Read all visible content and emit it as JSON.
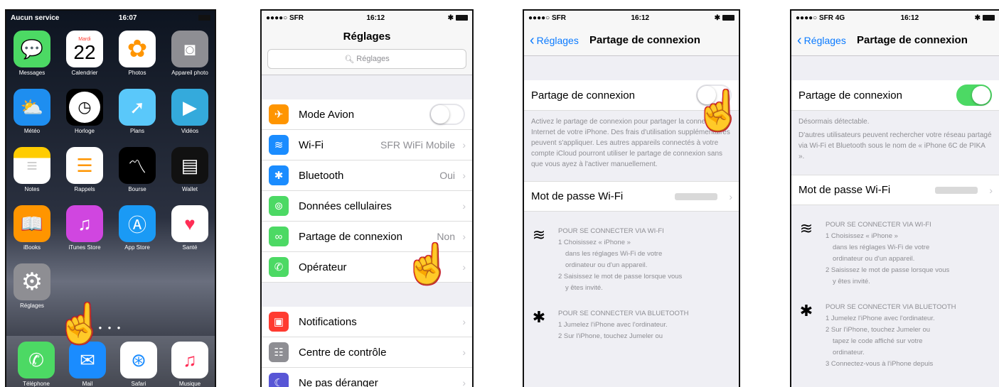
{
  "phone1": {
    "status": {
      "carrier": "Aucun service",
      "time": "16:07"
    },
    "apps": [
      {
        "label": "Messages",
        "color": "#4cd964"
      },
      {
        "label": "Calendrier",
        "color": "#ffffff",
        "day": "Mardi",
        "date": "22"
      },
      {
        "label": "Photos",
        "color": "#ffffff"
      },
      {
        "label": "Appareil photo",
        "color": "#8e8e93"
      },
      {
        "label": "Météo",
        "color": "#1e8ef0"
      },
      {
        "label": "Horloge",
        "color": "#000000"
      },
      {
        "label": "Plans",
        "color": "#5ac8fa"
      },
      {
        "label": "Vidéos",
        "color": "#34aadc"
      },
      {
        "label": "Notes",
        "color": "#ffcc00"
      },
      {
        "label": "Rappels",
        "color": "#ffffff"
      },
      {
        "label": "Bourse",
        "color": "#000000"
      },
      {
        "label": "Wallet",
        "color": "#111111"
      },
      {
        "label": "iBooks",
        "color": "#ff9500"
      },
      {
        "label": "iTunes Store",
        "color": "#d046e0"
      },
      {
        "label": "App Store",
        "color": "#1a9af5"
      },
      {
        "label": "Santé",
        "color": "#ffffff"
      },
      {
        "label": "Réglages",
        "color": "#8e8e93"
      }
    ],
    "dock": [
      {
        "label": "Téléphone",
        "color": "#4cd964"
      },
      {
        "label": "Mail",
        "color": "#1a8cff"
      },
      {
        "label": "Safari",
        "color": "#ffffff"
      },
      {
        "label": "Musique",
        "color": "#ffffff"
      }
    ]
  },
  "phone2": {
    "status": {
      "carrier": "●●●●○ SFR",
      "time": "16:12"
    },
    "title": "Réglages",
    "search_placeholder": "Réglages",
    "rows": [
      {
        "label": "Mode Avion",
        "value": "",
        "color": "#ff9500"
      },
      {
        "label": "Wi-Fi",
        "value": "SFR WiFi Mobile",
        "color": "#1a8cff"
      },
      {
        "label": "Bluetooth",
        "value": "Oui",
        "color": "#1a8cff"
      },
      {
        "label": "Données cellulaires",
        "value": "",
        "color": "#4cd964"
      },
      {
        "label": "Partage de connexion",
        "value": "Non",
        "color": "#4cd964"
      },
      {
        "label": "Opérateur",
        "value": "",
        "color": "#4cd964"
      },
      {
        "label": "Notifications",
        "value": "",
        "color": "#ff3b30"
      },
      {
        "label": "Centre de contrôle",
        "value": "",
        "color": "#8e8e93"
      },
      {
        "label": "Ne pas déranger",
        "value": "",
        "color": "#5856d6"
      }
    ]
  },
  "phone3": {
    "status": {
      "carrier": "●●●●○ SFR",
      "time": "16:12"
    },
    "back": "Réglages",
    "title": "Partage de connexion",
    "toggle_label": "Partage de connexion",
    "note": "Activez le partage de connexion pour partager la connexion Internet de votre iPhone. Des frais d'utilisation supplémentaires peuvent s'appliquer. Les autres appareils connectés à votre compte iCloud pourront utiliser le partage de connexion sans que vous ayez à l'activer manuellement.",
    "wifi_label": "Mot de passe Wi-Fi",
    "wifi_head": "POUR SE CONNECTER VIA WI-FI",
    "wifi_1": "1 Choisissez « iPhone »",
    "wifi_1b": "dans les réglages Wi-Fi de votre",
    "wifi_1c": "ordinateur ou d'un appareil.",
    "wifi_2": "2 Saisissez le mot de passe lorsque vous",
    "wifi_2b": "y êtes invité.",
    "bt_head": "POUR SE CONNECTER VIA BLUETOOTH",
    "bt_1": "1 Jumelez l'iPhone avec l'ordinateur.",
    "bt_2": "2 Sur l'iPhone, touchez Jumeler ou"
  },
  "phone4": {
    "status": {
      "carrier": "●●●●○ SFR 4G",
      "time": "16:12"
    },
    "back": "Réglages",
    "title": "Partage de connexion",
    "toggle_label": "Partage de connexion",
    "note_1": "Désormais détectable.",
    "note_2": "D'autres utilisateurs peuvent rechercher votre réseau partagé via Wi-Fi et Bluetooth sous le nom de « iPhone 6C de PIKA ».",
    "wifi_label": "Mot de passe Wi-Fi",
    "wifi_head": "POUR SE CONNECTER VIA WI-FI",
    "wifi_1": "1 Choisissez « iPhone »",
    "wifi_1b": "dans les réglages Wi-Fi de votre",
    "wifi_1c": "ordinateur ou d'un appareil.",
    "wifi_2": "2 Saisissez le mot de passe lorsque vous",
    "wifi_2b": "y êtes invité.",
    "bt_head": "POUR SE CONNECTER VIA BLUETOOTH",
    "bt_1": "1 Jumelez l'iPhone avec l'ordinateur.",
    "bt_2": "2 Sur l'iPhone, touchez Jumeler ou",
    "bt_2b": "tapez le code affiché sur votre",
    "bt_2c": "ordinateur.",
    "bt_3": "3 Connectez-vous à l'iPhone depuis"
  }
}
